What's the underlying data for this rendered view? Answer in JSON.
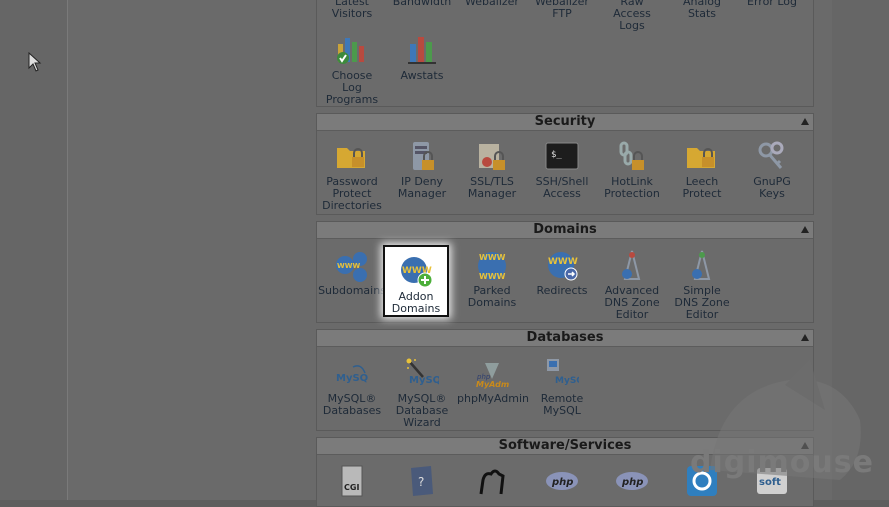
{
  "logs_panel": {
    "top_items": [
      {
        "label": "Latest\nVisitors"
      },
      {
        "label": "Bandwidth"
      },
      {
        "label": "Webalizer"
      },
      {
        "label": "Webalizer\nFTP"
      },
      {
        "label": "Raw\nAccess\nLogs"
      },
      {
        "label": "Analog\nStats"
      },
      {
        "label": "Error Log"
      }
    ],
    "items": [
      {
        "label": "Choose\nLog\nPrograms",
        "icon": "log-programs-icon"
      },
      {
        "label": "Awstats",
        "icon": "awstats-icon"
      }
    ]
  },
  "security": {
    "title": "Security",
    "items": [
      {
        "label": "Password\nProtect\nDirectories",
        "icon": "folder-lock-icon"
      },
      {
        "label": "IP Deny\nManager",
        "icon": "server-lock-icon"
      },
      {
        "label": "SSL/TLS\nManager",
        "icon": "certificate-lock-icon"
      },
      {
        "label": "SSH/Shell\nAccess",
        "icon": "terminal-icon"
      },
      {
        "label": "HotLink\nProtection",
        "icon": "chain-lock-icon"
      },
      {
        "label": "Leech\nProtect",
        "icon": "folder-lock-icon"
      },
      {
        "label": "GnuPG\nKeys",
        "icon": "keys-icon"
      }
    ]
  },
  "domains": {
    "title": "Domains",
    "items": [
      {
        "label": "Subdomains",
        "icon": "www-globes-icon"
      },
      {
        "label": "Addon\nDomains",
        "icon": "www-add-icon"
      },
      {
        "label": "Parked\nDomains",
        "icon": "www-parked-icon"
      },
      {
        "label": "Redirects",
        "icon": "www-redirect-icon"
      },
      {
        "label": "Advanced\nDNS Zone\nEditor",
        "icon": "dns-tower-icon"
      },
      {
        "label": "Simple\nDNS Zone\nEditor",
        "icon": "dns-tower-icon"
      }
    ]
  },
  "databases": {
    "title": "Databases",
    "items": [
      {
        "label": "MySQL®\nDatabases",
        "icon": "mysql-icon"
      },
      {
        "label": "MySQL®\nDatabase\nWizard",
        "icon": "mysql-wizard-icon"
      },
      {
        "label": "phpMyAdmin",
        "icon": "phpmyadmin-icon"
      },
      {
        "label": "Remote\nMySQL",
        "icon": "remote-mysql-icon"
      }
    ]
  },
  "software": {
    "title": "Software/Services",
    "items": [
      {
        "icon": "cgi-icon"
      },
      {
        "icon": "help-book-icon"
      },
      {
        "icon": "perl-camel-icon"
      },
      {
        "icon": "php-icon"
      },
      {
        "icon": "php-icon"
      },
      {
        "icon": "installer-icon"
      },
      {
        "icon": "softaculous-icon"
      }
    ]
  },
  "icon_text": {
    "ssh_prompt": "$_",
    "www": "WWW",
    "mysql": "MySQL",
    "php": "php",
    "pma": "MyAdmin",
    "cgi": "CGI",
    "soft": "soft"
  },
  "watermark": {
    "name": "digimouse"
  },
  "colors": {
    "accent": "#3a6fb0",
    "highlight": "#ffffff"
  }
}
